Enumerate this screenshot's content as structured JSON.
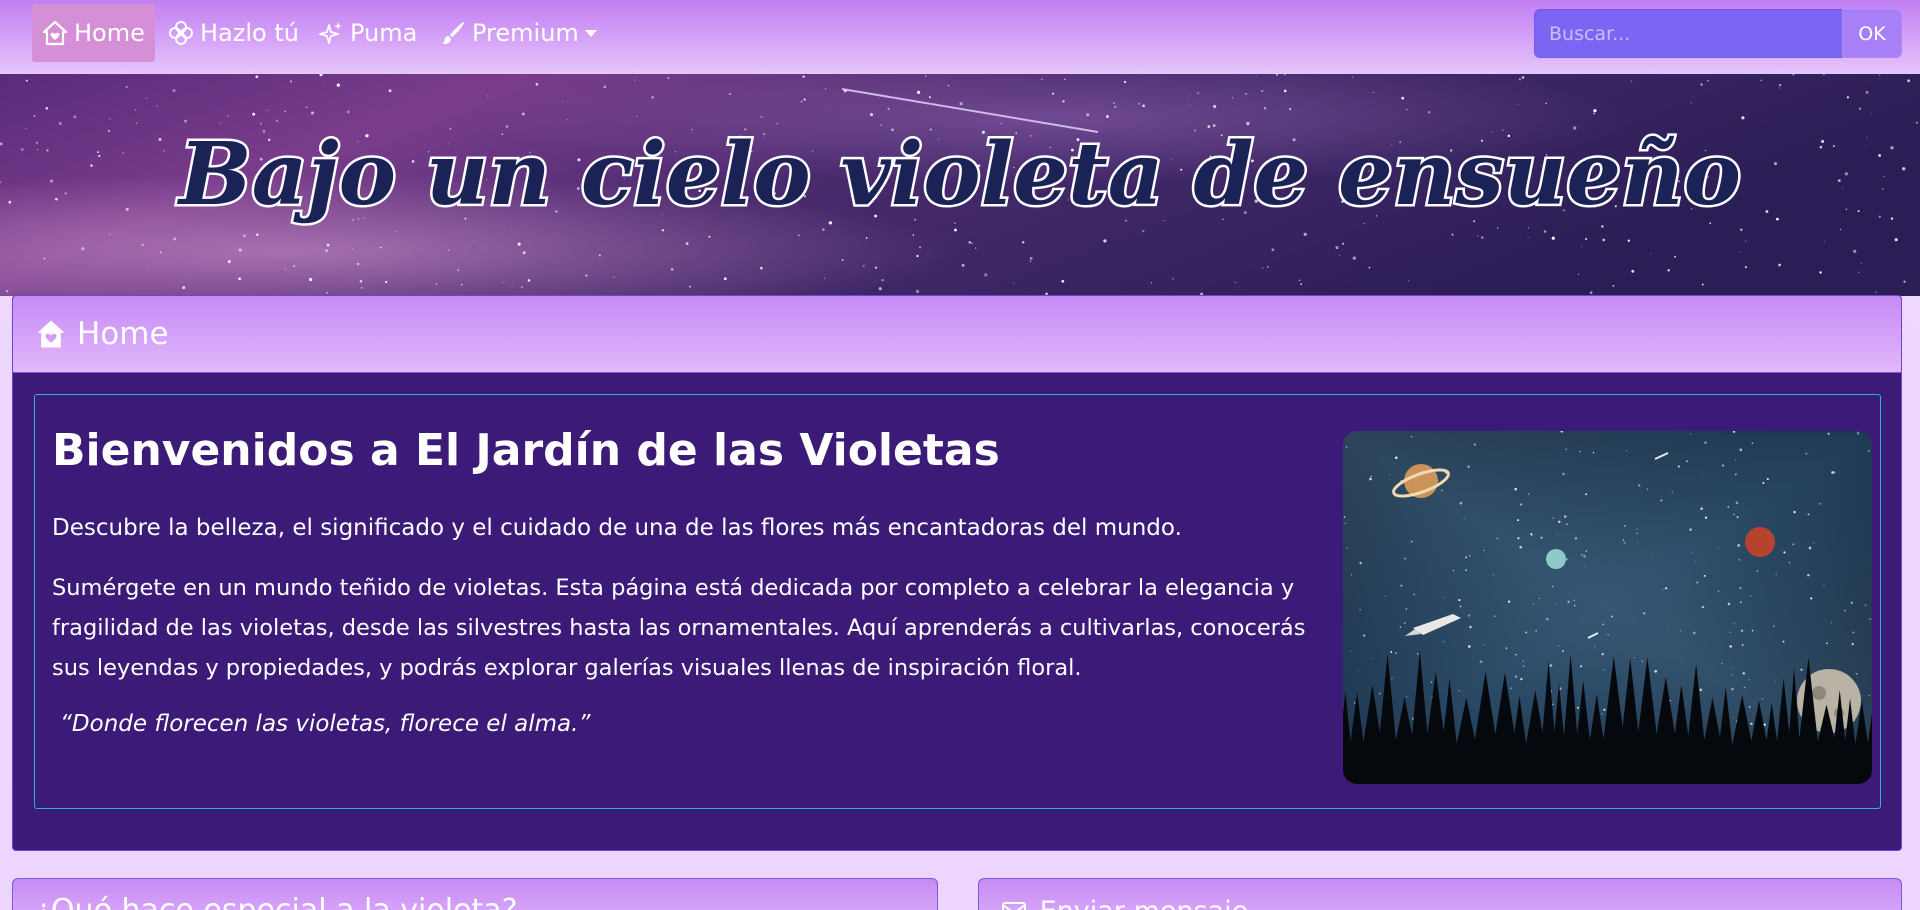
{
  "nav": {
    "items": [
      {
        "label": "Home",
        "icon": "house-heart-icon",
        "active": true
      },
      {
        "label": "Hazlo tú",
        "icon": "flower-icon"
      },
      {
        "label": "Puma",
        "icon": "sparkles-icon"
      },
      {
        "label": "Premium",
        "icon": "brush-icon",
        "dropdown": true
      }
    ],
    "search": {
      "placeholder": "Buscar...",
      "button_label": "OK"
    }
  },
  "banner": {
    "title": "Bajo un cielo violeta de ensueño"
  },
  "home_card": {
    "header": "Home",
    "title": "Bienvenidos a El Jardín de las Violetas",
    "intro": "Descubre la belleza, el significado y el cuidado de una de las flores más encantadoras del mundo.",
    "body": "Sumérgete en un mundo teñido de violetas. Esta página está dedicada por completo a celebrar la elegancia y fragilidad de las violetas, desde las silvestres hasta las ornamentales. Aquí aprenderás a cultivarlas, conocerás sus leyendas y propiedades, y podrás explorar galerías visuales llenas de inspiración floral.",
    "quote": "“Donde florecen las violetas, florece el alma.”"
  },
  "bottom_cards": {
    "left_title": "¿Qué hace especial a la violeta?",
    "right_title": "Enviar mensaje"
  },
  "colors": {
    "navbar": "#c17ff2",
    "card_body": "#3b1a78",
    "card_header": "#d3a0f8",
    "inner_border": "#2eb4c8",
    "search_bg": "#7a66f3"
  }
}
